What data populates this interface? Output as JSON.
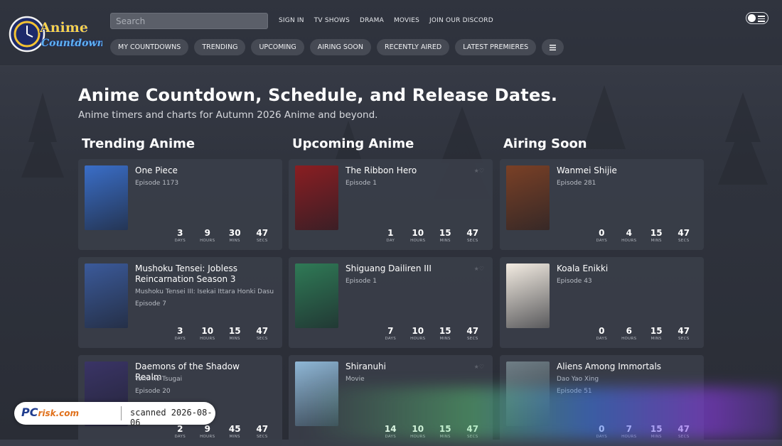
{
  "header": {
    "logo_text": "Anime Countdown",
    "search_placeholder": "Search",
    "top_links": [
      "SIGN IN",
      "TV SHOWS",
      "DRAMA",
      "MOVIES",
      "JOIN OUR DISCORD"
    ],
    "nav_pills": [
      "MY COUNTDOWNS",
      "TRENDING",
      "UPCOMING",
      "AIRING SOON",
      "RECENTLY AIRED",
      "LATEST PREMIERES"
    ],
    "menu_icon": "hamburger-icon",
    "theme_toggle_icon": "theme-toggle-icon"
  },
  "hero": {
    "title": "Anime Countdown, Schedule, and Release Dates.",
    "subtitle": "Anime timers and charts for Autumn 2026 Anime and beyond."
  },
  "columns": [
    {
      "title": "Trending Anime",
      "cards": [
        {
          "title": "One Piece",
          "lines": [
            "Episode 1173"
          ],
          "timer": [
            "3",
            "9",
            "30",
            "47"
          ],
          "labels": [
            "DAYS",
            "HOURS",
            "MINS",
            "SECS"
          ],
          "poster_color": "#3a6ec8"
        },
        {
          "title": "Mushoku Tensei: Jobless Reincarnation Season 3",
          "lines": [
            "Mushoku Tensei III: Isekai Ittara Honki Dasu",
            "Episode 7"
          ],
          "timer": [
            "3",
            "10",
            "15",
            "47"
          ],
          "labels": [
            "DAYS",
            "HOURS",
            "MINS",
            "SECS"
          ],
          "poster_color": "#3b5a9a"
        },
        {
          "title": "Daemons of the Shadow Realm",
          "lines": [
            "Yomi no Tsugai",
            "Episode 20"
          ],
          "timer": [
            "2",
            "9",
            "45",
            "47"
          ],
          "labels": [
            "DAYS",
            "HOURS",
            "MINS",
            "SECS"
          ],
          "poster_color": "#3a3466"
        }
      ]
    },
    {
      "title": "Upcoming Anime",
      "cards": [
        {
          "title": "The Ribbon Hero",
          "lines": [
            "Episode 1"
          ],
          "timer": [
            "1",
            "10",
            "15",
            "47"
          ],
          "labels": [
            "DAY",
            "HOURS",
            "MINS",
            "SECS"
          ],
          "poster_color": "#8a1e22"
        },
        {
          "title": "Shiguang Dailiren III",
          "lines": [
            "Episode 1"
          ],
          "timer": [
            "7",
            "10",
            "15",
            "47"
          ],
          "labels": [
            "DAYS",
            "HOURS",
            "MINS",
            "SECS"
          ],
          "poster_color": "#2f7a56"
        },
        {
          "title": "Shiranuhi",
          "lines": [
            "Movie"
          ],
          "timer": [
            "14",
            "10",
            "15",
            "47"
          ],
          "labels": [
            "DAYS",
            "HOURS",
            "MINS",
            "SECS"
          ],
          "poster_color": "#8fb7d6"
        }
      ]
    },
    {
      "title": "Airing Soon",
      "cards": [
        {
          "title": "Wanmei Shijie",
          "lines": [
            "Episode 281"
          ],
          "timer": [
            "0",
            "4",
            "15",
            "47"
          ],
          "labels": [
            "DAYS",
            "HOURS",
            "MINS",
            "SECS"
          ],
          "poster_color": "#7a4026"
        },
        {
          "title": "Koala Enikki",
          "lines": [
            "Episode 43"
          ],
          "timer": [
            "0",
            "6",
            "15",
            "47"
          ],
          "labels": [
            "DAYS",
            "HOURS",
            "MINS",
            "SECS"
          ],
          "poster_color": "#f3ece2"
        },
        {
          "title": "Aliens Among Immortals",
          "lines": [
            "Dao Yao Xing",
            "Episode 51"
          ],
          "timer": [
            "0",
            "7",
            "15",
            "47"
          ],
          "labels": [
            "DAYS",
            "HOURS",
            "MINS",
            "SECS"
          ],
          "poster_color": "#6f7e86"
        }
      ]
    }
  ],
  "watermark": {
    "brand": "PC",
    "brand_suffix": "risk.com",
    "scan_text": "scanned 2026-08-06"
  }
}
